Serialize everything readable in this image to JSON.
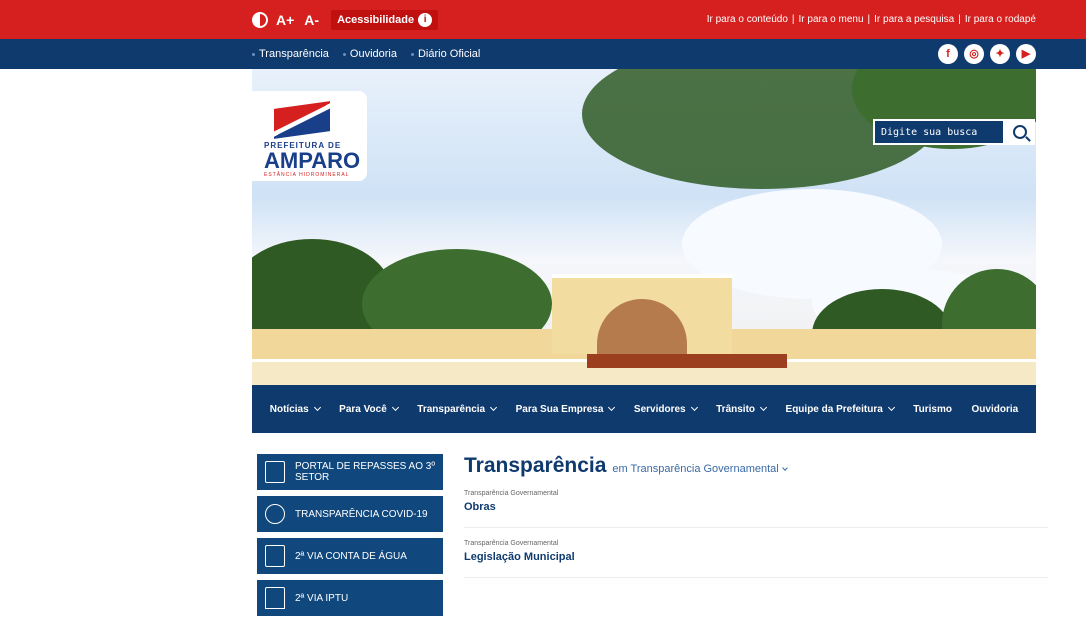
{
  "topbar": {
    "font_increase": "A+",
    "font_decrease": "A-",
    "accessibility_label": "Acessibilidade",
    "skip_links": [
      "Ir para o conteúdo",
      "Ir para o menu",
      "Ir para a pesquisa",
      "Ir para o rodapé"
    ]
  },
  "quick_links": [
    "Transparência",
    "Ouvidoria",
    "Diário Oficial"
  ],
  "social": [
    {
      "icon": "facebook-icon",
      "glyph": "f"
    },
    {
      "icon": "instagram-icon",
      "glyph": "◎"
    },
    {
      "icon": "twitter-icon",
      "glyph": "✦"
    },
    {
      "icon": "youtube-icon",
      "glyph": "▶"
    }
  ],
  "logo": {
    "line1": "PREFEITURA DE",
    "line2": "AMPARO",
    "line3": "ESTÂNCIA HIDROMINERAL"
  },
  "search": {
    "placeholder": "Digite sua busca"
  },
  "main_nav": [
    {
      "label": "Notícias",
      "dropdown": true
    },
    {
      "label": "Para Você",
      "dropdown": true
    },
    {
      "label": "Transparência",
      "dropdown": true
    },
    {
      "label": "Para Sua Empresa",
      "dropdown": true
    },
    {
      "label": "Servidores",
      "dropdown": true
    },
    {
      "label": "Trânsito",
      "dropdown": true
    },
    {
      "label": "Equipe da Prefeitura",
      "dropdown": true
    },
    {
      "label": "Turismo",
      "dropdown": false
    },
    {
      "label": "Ouvidoria",
      "dropdown": false
    }
  ],
  "sidebar": [
    {
      "label": "PORTAL DE REPASSES AO 3º SETOR",
      "icon": "document-icon"
    },
    {
      "label": "TRANSPARÊNCIA COVID-19",
      "icon": "magnifier-icon"
    },
    {
      "label": "2ª VIA CONTA DE ÁGUA",
      "icon": "water-tap-icon"
    },
    {
      "label": "2ª VIA IPTU",
      "icon": "house-icon"
    }
  ],
  "content": {
    "title": "Transparência",
    "subtitle": "em Transparência Governamental",
    "entries": [
      {
        "category": "Transparência Governamental",
        "title": "Obras"
      },
      {
        "category": "Transparência Governamental",
        "title": "Legislação Municipal"
      }
    ]
  },
  "colors": {
    "red_bar": "#d61f1f",
    "navy": "#0f3a6e",
    "sidebar_blue": "#10477d"
  }
}
